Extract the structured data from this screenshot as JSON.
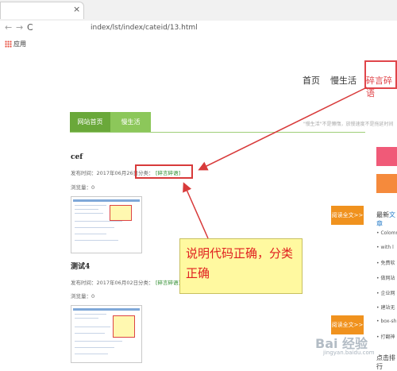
{
  "browser": {
    "tab_close": "×",
    "back": "←",
    "forward": "→",
    "reload": "C",
    "url": "index/lst/index/cateid/13.html",
    "bookmarks_apps": "应用"
  },
  "site_nav": {
    "items": [
      "首页",
      "慢生活",
      "碎言碎语"
    ]
  },
  "tabs": {
    "home": "网站首页",
    "life": "慢生活"
  },
  "slogan": "\"慢生活\"不是懒惰，放慢速度不是拖延时间",
  "articles": [
    {
      "title": "cef",
      "date": "发布时间：2017年06月26日",
      "category_label": "分类：",
      "category": "[碎言碎语]",
      "views": "浏览量：0",
      "read_more": "阅读全文>>"
    },
    {
      "title": "测试4",
      "date": "发布时间：2017年06月02日",
      "category_label": "分类：",
      "category": "[碎言碎语]",
      "views": "浏览量：0",
      "read_more": "阅读全文>>"
    }
  ],
  "sidebar": {
    "title_prefix": "最新",
    "title_suffix": "文章",
    "items": [
      "• Colomn",
      "• with l",
      "• 免费软",
      "• 做网站",
      "• 企业网",
      "• 建站无",
      "• box-sh",
      "• 打翻神"
    ],
    "bottom": "点击排行"
  },
  "annotation": {
    "text": "说明代码正确，分类正确"
  },
  "watermark": {
    "logo": "Bai 经验",
    "url": "jingyan.baidu.com"
  },
  "colors": {
    "accent_red": "#e0454a",
    "tab_green": "#6aa83a",
    "tab_green_light": "#8cc75a",
    "read_more_orange": "#f0921e",
    "callout_yellow": "#fff9a0"
  }
}
